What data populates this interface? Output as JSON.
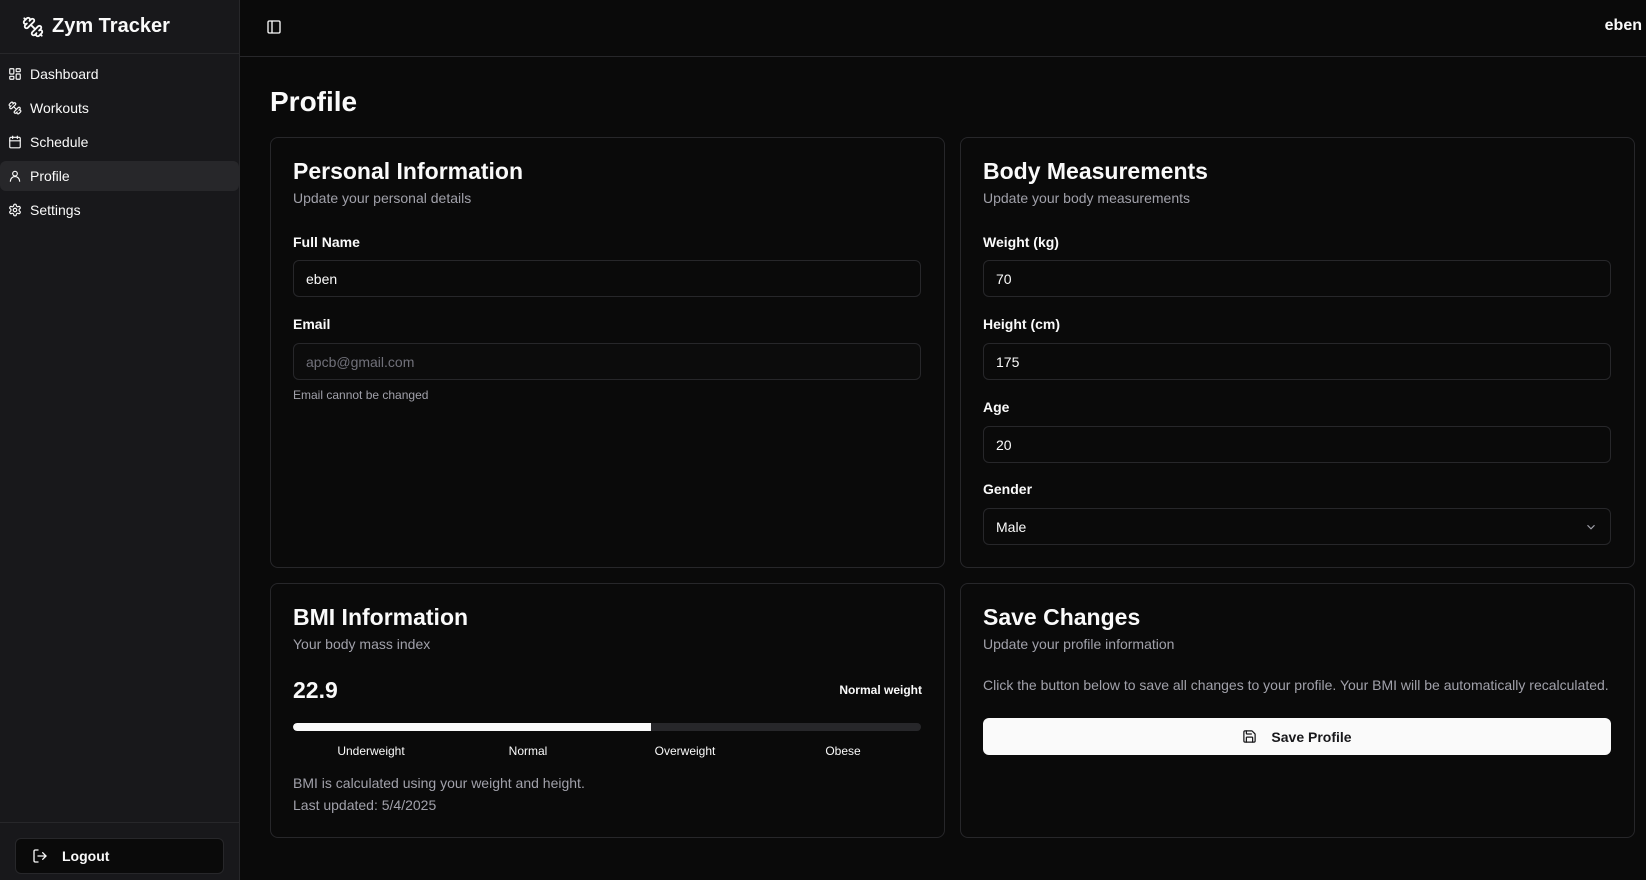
{
  "app": {
    "title": "Zym Tracker",
    "user": "eben"
  },
  "sidebar": {
    "items": [
      {
        "label": "Dashboard",
        "icon": "layout-dashboard-icon",
        "active": false
      },
      {
        "label": "Workouts",
        "icon": "dumbbell-icon",
        "active": false
      },
      {
        "label": "Schedule",
        "icon": "calendar-icon",
        "active": false
      },
      {
        "label": "Profile",
        "icon": "user-icon",
        "active": true
      },
      {
        "label": "Settings",
        "icon": "gear-icon",
        "active": false
      }
    ],
    "logout_label": "Logout"
  },
  "page": {
    "title": "Profile"
  },
  "personal": {
    "title": "Personal Information",
    "subtitle": "Update your personal details",
    "full_name_label": "Full Name",
    "full_name_value": "eben",
    "email_label": "Email",
    "email_value": "apcb@gmail.com",
    "email_hint": "Email cannot be changed"
  },
  "body": {
    "title": "Body Measurements",
    "subtitle": "Update your body measurements",
    "weight_label": "Weight (kg)",
    "weight_value": "70",
    "height_label": "Height (cm)",
    "height_value": "175",
    "age_label": "Age",
    "age_value": "20",
    "gender_label": "Gender",
    "gender_value": "Male"
  },
  "bmi": {
    "title": "BMI Information",
    "subtitle": "Your body mass index",
    "value": "22.9",
    "category": "Normal weight",
    "progress_percent": 57,
    "scale": [
      "Underweight",
      "Normal",
      "Overweight",
      "Obese"
    ],
    "note": "BMI is calculated using your weight and height.",
    "last_updated": "Last updated: 5/4/2025"
  },
  "save": {
    "title": "Save Changes",
    "subtitle": "Update your profile information",
    "description": "Click the button below to save all changes to your profile. Your BMI will be automatically recalculated.",
    "button_label": "Save Profile"
  },
  "colors": {
    "background": "#0a0a0a",
    "sidebar": "#18181b",
    "border": "#27272a",
    "text": "#fafafa",
    "muted": "#a1a1aa"
  }
}
